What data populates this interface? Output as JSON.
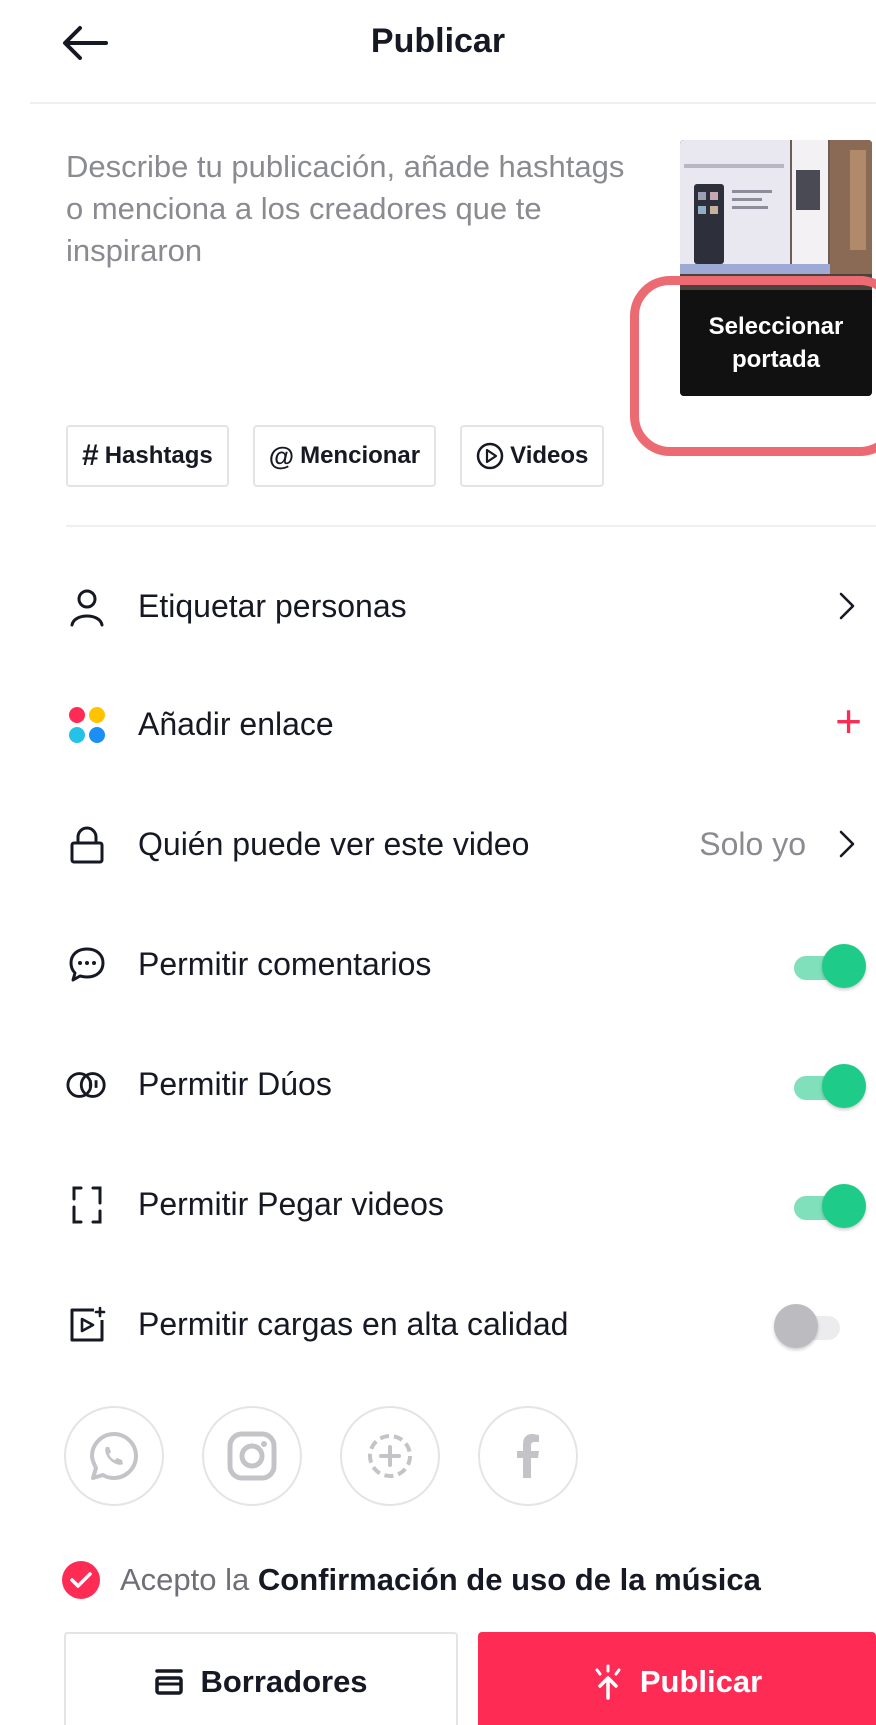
{
  "header": {
    "title": "Publicar",
    "back_icon": "arrow-left-icon"
  },
  "caption": {
    "placeholder": "Describe tu publicación, añade hashtags o menciona a los creadores que te inspiraron"
  },
  "cover": {
    "label": "Seleccionar portada",
    "highlight_color": "#ec6b73"
  },
  "chips": [
    {
      "icon": "hashtag-icon",
      "label": "Hashtags"
    },
    {
      "icon": "at-icon",
      "label": "Mencionar"
    },
    {
      "icon": "play-circle-icon",
      "label": "Videos"
    }
  ],
  "settings": {
    "tag_people": {
      "label": "Etiquetar personas"
    },
    "add_link": {
      "label": "Añadir enlace"
    },
    "visibility": {
      "label": "Quién puede ver este video",
      "value": "Solo yo"
    },
    "comments": {
      "label": "Permitir comentarios",
      "enabled": true
    },
    "duets": {
      "label": "Permitir Dúos",
      "enabled": true
    },
    "stitch": {
      "label": "Permitir Pegar videos",
      "enabled": true
    },
    "hq_upload": {
      "label": "Permitir cargas en alta calidad",
      "enabled": false
    }
  },
  "share_targets": [
    "whatsapp-icon",
    "instagram-icon",
    "add-story-icon",
    "facebook-icon"
  ],
  "consent": {
    "prefix": "Acepto la",
    "link": "Confirmación de uso de la música",
    "checked": true
  },
  "actions": {
    "drafts_label": "Borradores",
    "publish_label": "Publicar"
  },
  "colors": {
    "accent": "#fe2c55",
    "toggle_on": "#1fcb88",
    "muted_text": "#8a8b91"
  }
}
